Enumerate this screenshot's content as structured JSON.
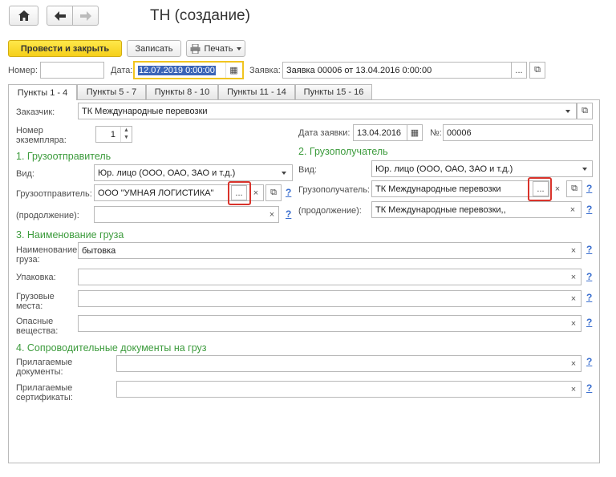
{
  "title": "ТН (создание)",
  "toolbar": {
    "post_close": "Провести и закрыть",
    "save": "Записать",
    "print": "Печать",
    "ellipsis": "..."
  },
  "header": {
    "number_label": "Номер:",
    "number_value": "",
    "date_label": "Дата:",
    "date_value": "12.07.2019  0:00:00",
    "order_label": "Заявка:",
    "order_value": "Заявка 00006 от 13.04.2016 0:00:00"
  },
  "tabs": [
    "Пункты 1 - 4",
    "Пункты 5 - 7",
    "Пункты 8 - 10",
    "Пункты 11 - 14",
    "Пункты 15 - 16"
  ],
  "customer": {
    "label": "Заказчик:",
    "value": "ТК Международные перевозки"
  },
  "copy_number": {
    "label1": "Номер",
    "label2": "экземпляра:",
    "value": "1"
  },
  "order_date": {
    "label": "Дата заявки:",
    "value": "13.04.2016",
    "num_label": "№:",
    "num_value": "00006"
  },
  "shipper": {
    "title": "1. Грузоотправитель",
    "kind_label": "Вид:",
    "kind_value": "Юр. лицо (ООО, ОАО, ЗАО и т.д.)",
    "name_label": "Грузоотправитель:",
    "name_value": "ООО \"УМНАЯ ЛОГИСТИКА\"",
    "cont_label": "(продолжение):",
    "cont_value": ""
  },
  "consignee": {
    "title": "2. Грузополучатель",
    "kind_label": "Вид:",
    "kind_value": "Юр. лицо (ООО, ОАО, ЗАО и т.д.)",
    "name_label": "Грузополучатель:",
    "name_value": "ТК Международные перевозки",
    "cont_label": "(продолжение):",
    "cont_value": "ТК Международные перевозки,,"
  },
  "cargo": {
    "title": "3. Наименование груза",
    "name_label1": "Наименование",
    "name_label2": "груза:",
    "name_value": "бытовка",
    "pack_label": "Упаковка:",
    "pack_value": "",
    "places_label1": "Грузовые",
    "places_label2": "места:",
    "places_value": "",
    "danger_label1": "Опасные",
    "danger_label2": "вещества:",
    "danger_value": ""
  },
  "docs": {
    "title": "4. Сопроводительные документы на груз",
    "attached_label1": "Прилагаемые",
    "attached_label2": "документы:",
    "attached_value": "",
    "certs_label1": "Прилагаемые",
    "certs_label2": "сертификаты:",
    "certs_value": ""
  },
  "glyphs": {
    "clear": "×",
    "help": "?",
    "dots": "...",
    "copy": "⧉",
    "calendar": "▦"
  },
  "colors": {
    "accent_green": "#3c9b3c",
    "primary_yellow": "#f5cf1a",
    "highlight_red": "#d9332b",
    "help_blue": "#3b6fcf"
  }
}
